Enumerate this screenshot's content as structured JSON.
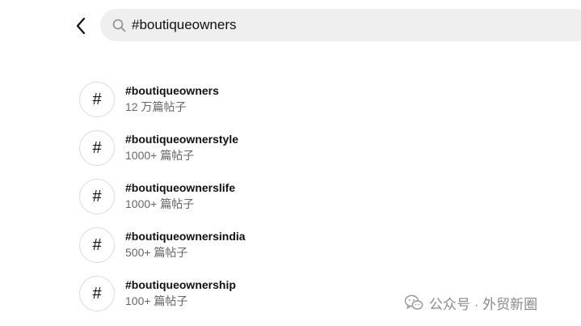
{
  "search": {
    "value": "#boutiqueowners"
  },
  "results": [
    {
      "hash": "#",
      "tag": "#boutiqueowners",
      "count": "12 万篇帖子"
    },
    {
      "hash": "#",
      "tag": "#boutiqueownerstyle",
      "count": "1000+ 篇帖子"
    },
    {
      "hash": "#",
      "tag": "#boutiqueownerslife",
      "count": "1000+ 篇帖子"
    },
    {
      "hash": "#",
      "tag": "#boutiqueownersindia",
      "count": "500+ 篇帖子"
    },
    {
      "hash": "#",
      "tag": "#boutiqueownership",
      "count": "100+ 篇帖子"
    }
  ],
  "watermark": {
    "text": "公众号 · 外贸新圈"
  },
  "icons": {
    "back": "chevron-left-icon",
    "search": "search-icon",
    "watermark": "wechat-logo-icon"
  },
  "colors": {
    "search_bg": "#efefef",
    "secondary_text": "#666666",
    "circle_border": "#dbdbdb"
  }
}
